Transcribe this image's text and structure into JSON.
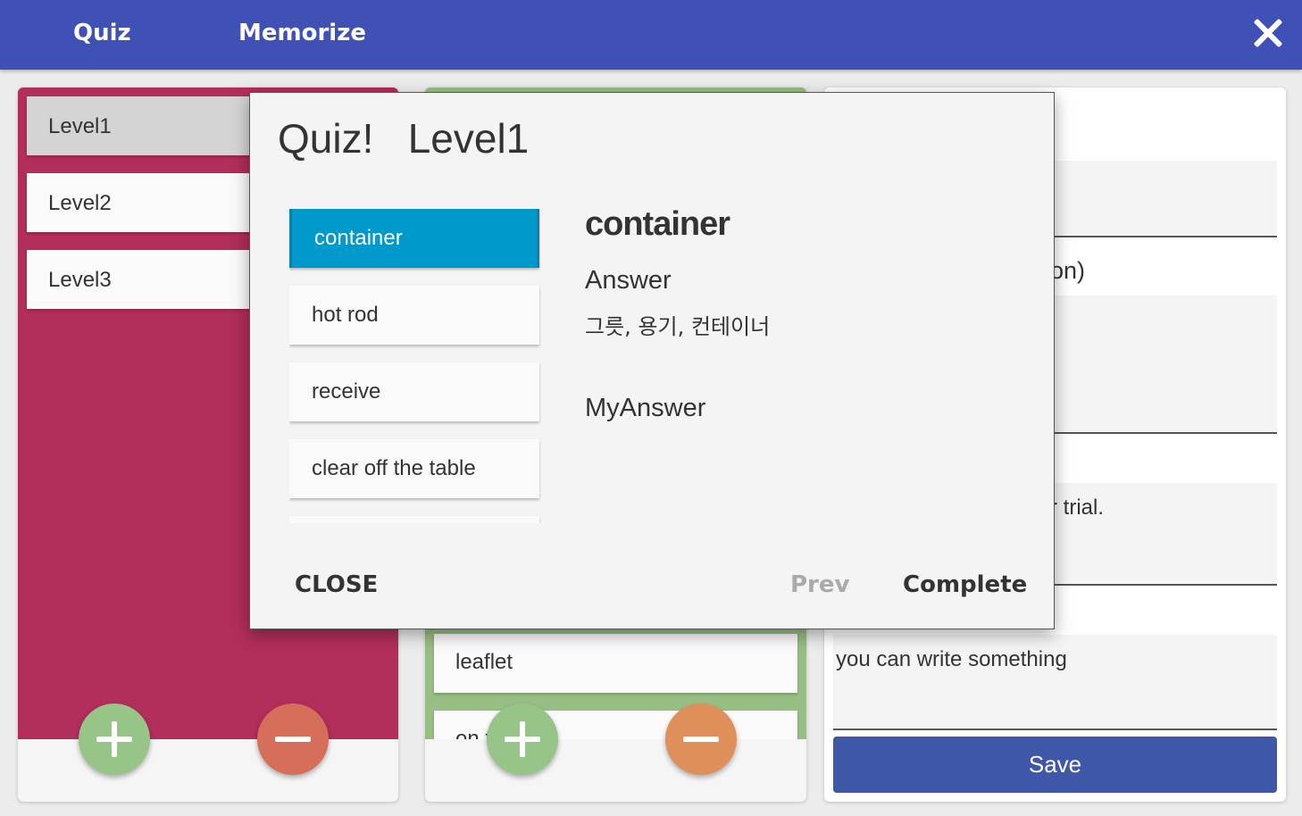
{
  "header": {
    "tabs": [
      "Quiz",
      "Memorize"
    ],
    "close_icon": "close-icon"
  },
  "levels": {
    "items": [
      "Level1",
      "Level2",
      "Level3"
    ],
    "selected": "Level1",
    "color": "#b22e5b"
  },
  "words": {
    "color": "#97bf84",
    "items": [
      "leaflet",
      "on t... r"
    ]
  },
  "detail": {
    "partial_text_1": "on)",
    "partial_text_2": "r trial.",
    "memo_placeholder": "you can write something",
    "save_label": "Save"
  },
  "dialog": {
    "title": "Quiz!   Level1",
    "items": [
      "container",
      "hot rod",
      "receive",
      "clear off the table"
    ],
    "active_item": "container",
    "word": "container",
    "answer_label": "Answer",
    "answer": "그릇, 용기, 컨테이너",
    "my_answer_label": "MyAnswer",
    "close_label": "CLOSE",
    "prev_label": "Prev",
    "complete_label": "Complete"
  }
}
